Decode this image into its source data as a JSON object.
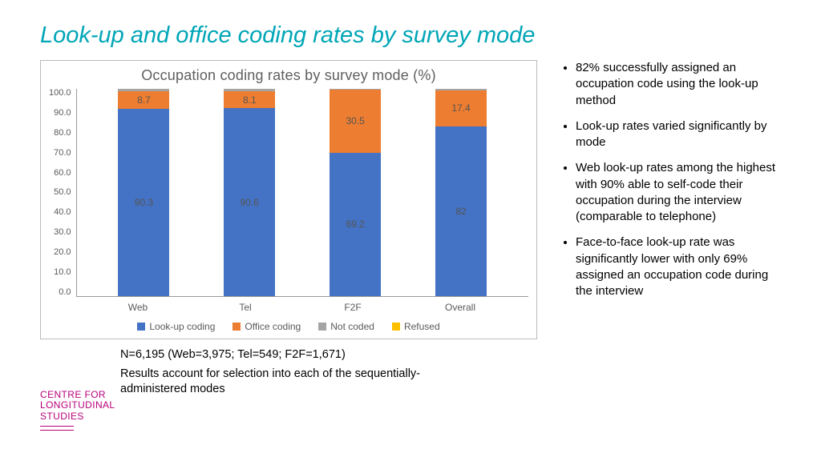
{
  "title": "Look-up and office coding rates by survey mode",
  "chart_data": {
    "type": "bar",
    "stacked": true,
    "title": "Occupation coding rates by survey mode (%)",
    "categories": [
      "Web",
      "Tel",
      "F2F",
      "Overall"
    ],
    "series": [
      {
        "name": "Look-up coding",
        "values": [
          90.3,
          90.6,
          69.2,
          82.0
        ],
        "color": "#4472c4"
      },
      {
        "name": "Office coding",
        "values": [
          8.7,
          8.1,
          30.5,
          17.4
        ],
        "color": "#ed7d31"
      },
      {
        "name": "Not coded",
        "values": [
          1.0,
          1.3,
          0.3,
          0.6
        ],
        "color": "#a5a5a5"
      },
      {
        "name": "Refused",
        "values": [
          0.0,
          0.0,
          0.0,
          0.0
        ],
        "color": "#ffc000"
      }
    ],
    "ylim": [
      0,
      100
    ],
    "yticks": [
      "100.0",
      "90.0",
      "80.0",
      "70.0",
      "60.0",
      "50.0",
      "40.0",
      "30.0",
      "20.0",
      "10.0",
      "0.0"
    ],
    "xlabel": "",
    "ylabel": ""
  },
  "legend": {
    "items": [
      "Look-up coding",
      "Office coding",
      "Not coded",
      "Refused"
    ]
  },
  "notes": {
    "line1": "N=6,195 (Web=3,975; Tel=549; F2F=1,671)",
    "line2": "Results account for selection into each of the sequentially-administered modes"
  },
  "bullets": {
    "b1": "82% successfully assigned an occupation code using the look-up method",
    "b2": "Look-up rates varied significantly by mode",
    "b3": "Web look-up rates among the highest with 90% able to self-code their occupation during the interview (comparable to telephone)",
    "b4": "Face-to-face look-up rate was significantly lower with only 69% assigned an occupation code during the interview"
  },
  "logo": {
    "l1": "CENTRE FOR",
    "l2": "LONGITUDINAL",
    "l3": "STUDIES"
  }
}
